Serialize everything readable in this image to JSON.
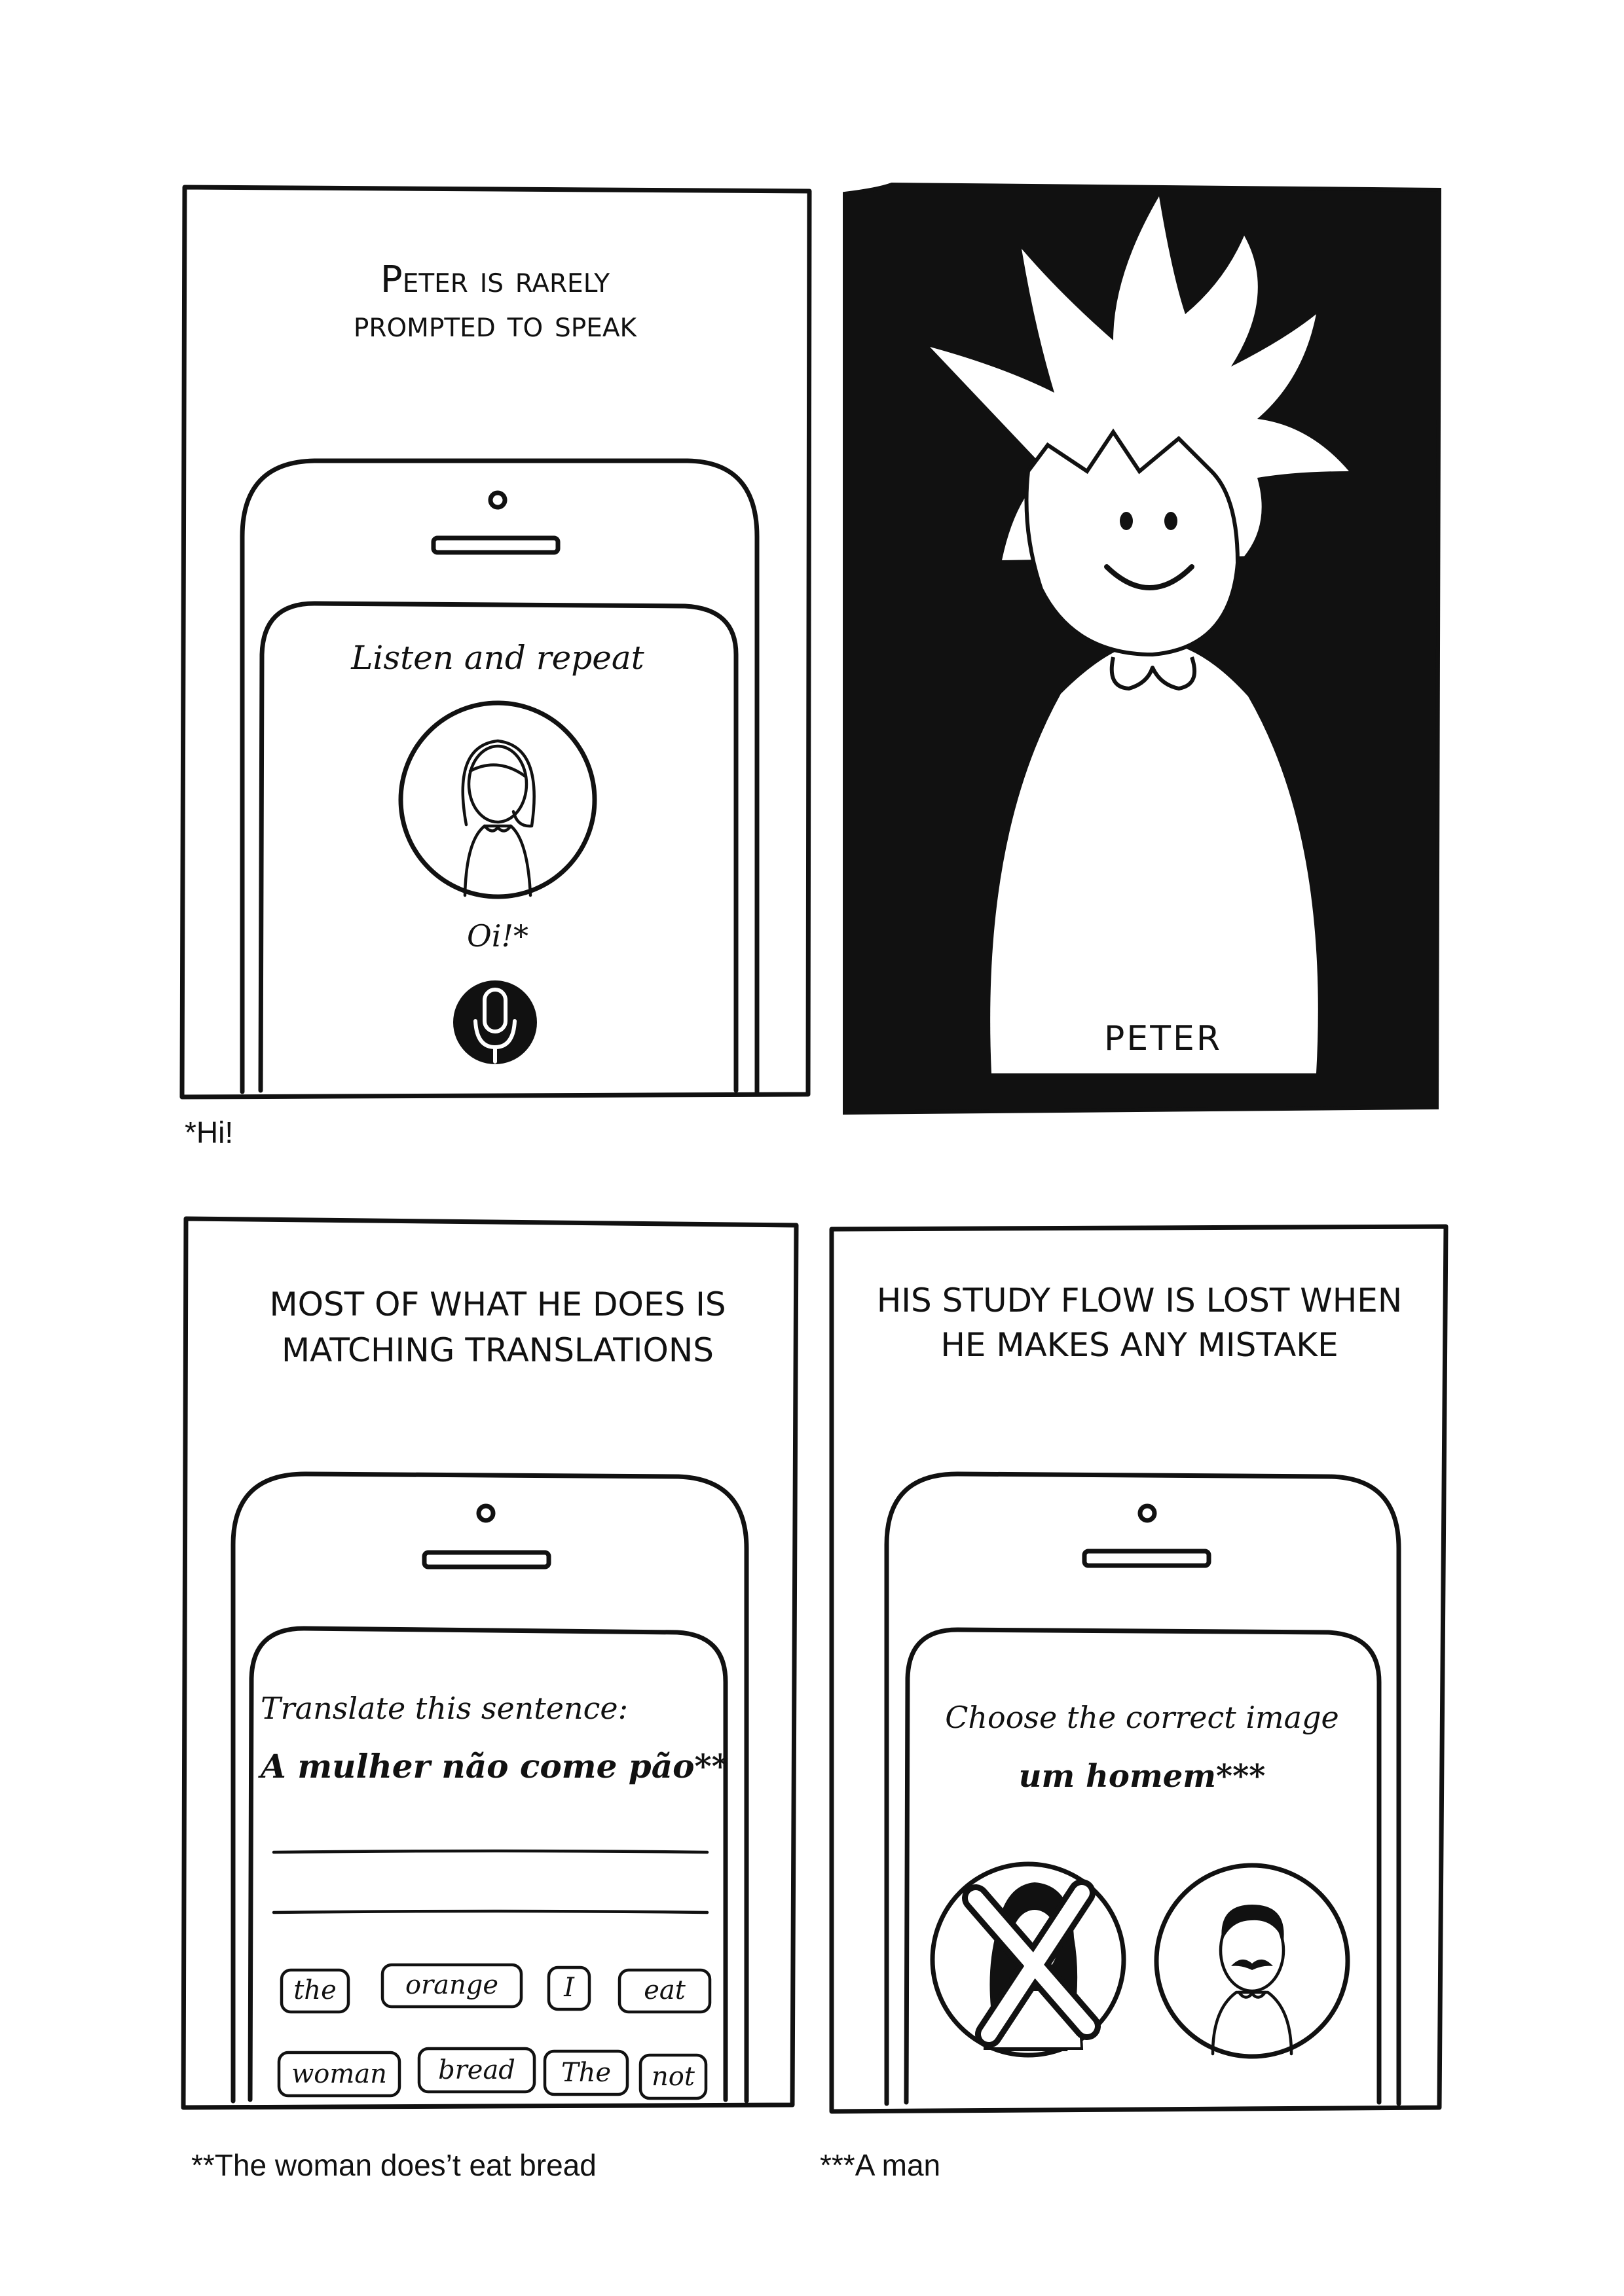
{
  "panel1": {
    "caption_line1": "Peter is rarely",
    "caption_line2": "prompted to speak",
    "screen_title": "Listen and repeat",
    "speech_word": "Oi!*",
    "footnote": "*Hi!"
  },
  "panel2": {
    "name_label": "PETER"
  },
  "panel3": {
    "caption_line1": "MOST OF WHAT HE DOES IS",
    "caption_line2": "MATCHING TRANSLATIONS",
    "screen_title": "Translate this sentence:",
    "sentence": "A mulher não come pão**",
    "word_bank": [
      "the",
      "orange",
      "I",
      "eat",
      "woman",
      "bread",
      "The",
      "not"
    ],
    "footnote": "**The woman does’t eat bread"
  },
  "panel4": {
    "caption_line1": "HIS STUDY FLOW IS LOST WHEN",
    "caption_line2": "HE MAKES ANY MISTAKE",
    "screen_title": "Choose the correct image",
    "target_word": "um homem***",
    "footnote": "***A man"
  },
  "colors": {
    "ink": "#111111",
    "paper": "#ffffff"
  },
  "icons": [
    "microphone-icon",
    "woman-avatar-icon",
    "man-avatar-icon",
    "wrong-cross-icon"
  ]
}
